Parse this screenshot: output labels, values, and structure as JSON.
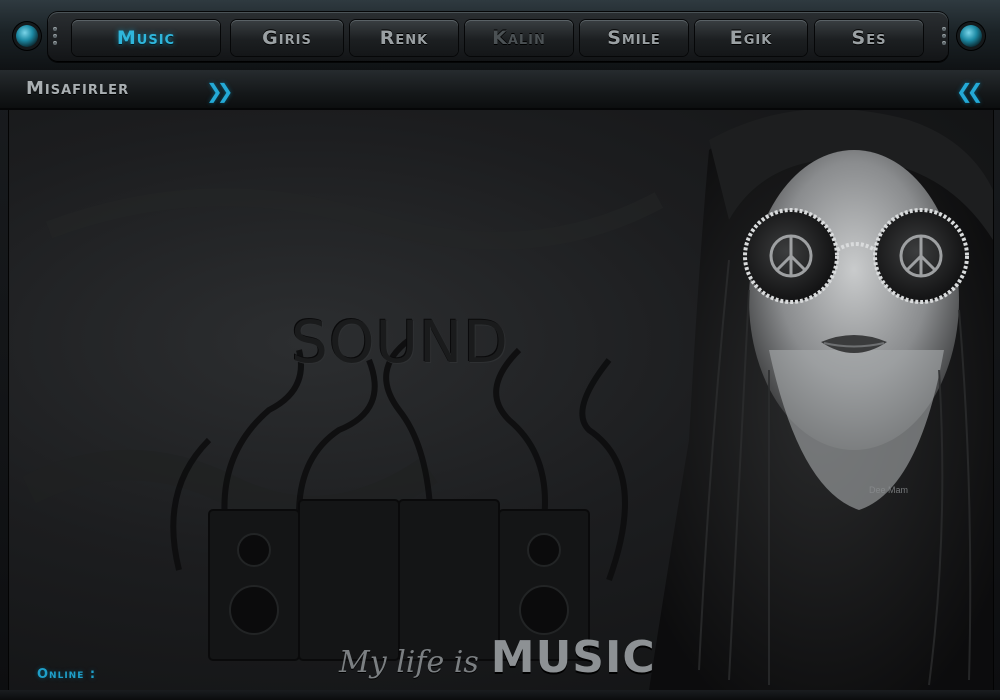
{
  "nav": {
    "tabs": [
      {
        "label": "Music",
        "state": "active"
      },
      {
        "label": "Giris",
        "state": "normal"
      },
      {
        "label": "Renk",
        "state": "normal"
      },
      {
        "label": "Kalin",
        "state": "dim"
      },
      {
        "label": "Smile",
        "state": "normal"
      },
      {
        "label": "Egik",
        "state": "normal"
      },
      {
        "label": "Ses",
        "state": "normal"
      }
    ]
  },
  "header": {
    "title": "Misafirler",
    "expand_icon": "double-chevron-right-icon",
    "collapse_icon": "double-chevron-left-icon"
  },
  "banner": {
    "watermark": "SOUND",
    "signature": "Dee Mam",
    "tagline_script": "My life is",
    "tagline_bold": "MUSIC"
  },
  "status": {
    "online_label": "Online :"
  },
  "colors": {
    "accent": "#24a9d6",
    "frame": "#1b2327",
    "text_muted": "#9aa0a3"
  }
}
